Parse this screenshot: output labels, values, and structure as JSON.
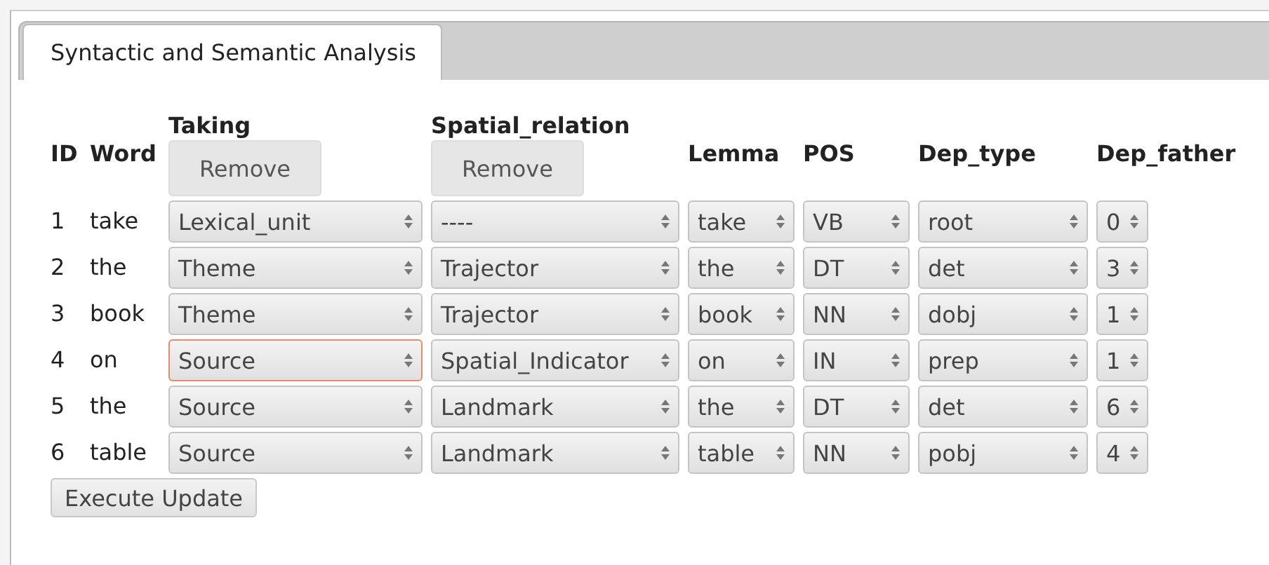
{
  "tabs": [
    {
      "label": "Syntactic and Semantic Analysis",
      "selected": true
    }
  ],
  "columns": [
    {
      "label": "ID",
      "kind": "text"
    },
    {
      "label": "Word",
      "kind": "text"
    },
    {
      "label": "Taking",
      "kind": "select",
      "button": "Remove"
    },
    {
      "label": "Spatial_relation",
      "kind": "select",
      "button": "Remove"
    },
    {
      "label": "Lemma",
      "kind": "select"
    },
    {
      "label": "POS",
      "kind": "select"
    },
    {
      "label": "Dep_type",
      "kind": "select"
    },
    {
      "label": "Dep_father",
      "kind": "select"
    }
  ],
  "rows": [
    {
      "cells": [
        {
          "value": "1"
        },
        {
          "value": "take"
        },
        {
          "value": "Lexical_unit",
          "focused": false
        },
        {
          "value": "----",
          "focused": false
        },
        {
          "value": "take",
          "focused": false
        },
        {
          "value": "VB",
          "focused": false
        },
        {
          "value": "root",
          "focused": false
        },
        {
          "value": "0",
          "focused": false
        }
      ]
    },
    {
      "cells": [
        {
          "value": "2"
        },
        {
          "value": "the"
        },
        {
          "value": "Theme",
          "focused": false
        },
        {
          "value": "Trajector",
          "focused": false
        },
        {
          "value": "the",
          "focused": false
        },
        {
          "value": "DT",
          "focused": false
        },
        {
          "value": "det",
          "focused": false
        },
        {
          "value": "3",
          "focused": false
        }
      ]
    },
    {
      "cells": [
        {
          "value": "3"
        },
        {
          "value": "book"
        },
        {
          "value": "Theme",
          "focused": false
        },
        {
          "value": "Trajector",
          "focused": false
        },
        {
          "value": "book",
          "focused": false
        },
        {
          "value": "NN",
          "focused": false
        },
        {
          "value": "dobj",
          "focused": false
        },
        {
          "value": "1",
          "focused": false
        }
      ]
    },
    {
      "cells": [
        {
          "value": "4"
        },
        {
          "value": "on"
        },
        {
          "value": "Source",
          "focused": true
        },
        {
          "value": "Spatial_Indicator",
          "focused": false
        },
        {
          "value": "on",
          "focused": false
        },
        {
          "value": "IN",
          "focused": false
        },
        {
          "value": "prep",
          "focused": false
        },
        {
          "value": "1",
          "focused": false
        }
      ]
    },
    {
      "cells": [
        {
          "value": "5"
        },
        {
          "value": "the"
        },
        {
          "value": "Source",
          "focused": false
        },
        {
          "value": "Landmark",
          "focused": false
        },
        {
          "value": "the",
          "focused": false
        },
        {
          "value": "DT",
          "focused": false
        },
        {
          "value": "det",
          "focused": false
        },
        {
          "value": "6",
          "focused": false
        }
      ]
    },
    {
      "cells": [
        {
          "value": "6"
        },
        {
          "value": "table"
        },
        {
          "value": "Source",
          "focused": false
        },
        {
          "value": "Landmark",
          "focused": false
        },
        {
          "value": "table",
          "focused": false
        },
        {
          "value": "NN",
          "focused": false
        },
        {
          "value": "pobj",
          "focused": false
        },
        {
          "value": "4",
          "focused": false
        }
      ]
    }
  ],
  "update_button": "Execute Update"
}
